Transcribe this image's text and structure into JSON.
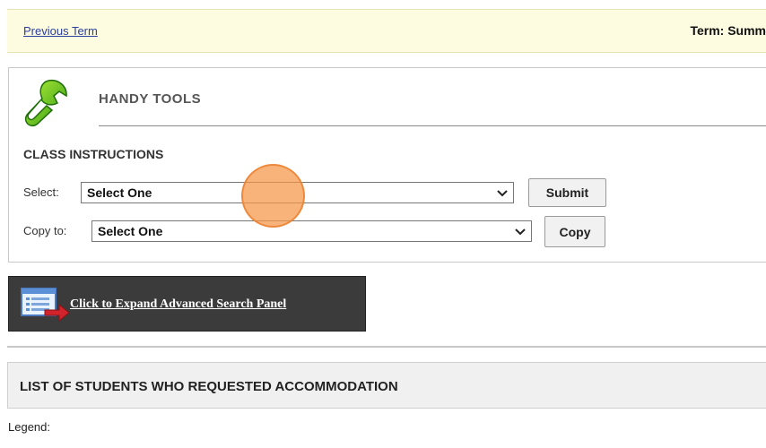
{
  "topbar": {
    "previous_term_link": "Previous Term",
    "term_label": "Term: Summ"
  },
  "handy_tools": {
    "title": "HANDY TOOLS",
    "icon": "wrench-icon",
    "section_heading": "CLASS INSTRUCTIONS",
    "select_row": {
      "label": "Select:",
      "value": "Select One",
      "button": "Submit"
    },
    "copy_row": {
      "label": "Copy to:",
      "value": "Select One",
      "button": "Copy"
    }
  },
  "advanced_search": {
    "icon": "search-panel-icon",
    "label": "Click to Expand Advanced Search Panel"
  },
  "student_list": {
    "title": "LIST OF STUDENTS WHO REQUESTED ACCOMMODATION",
    "legend_label": "Legend:"
  },
  "colors": {
    "topbar_bg": "#fdfbe0",
    "link": "#2a3f9e",
    "expand_bar_bg": "#3b3b3b",
    "cursor_highlight": "#f49646"
  }
}
